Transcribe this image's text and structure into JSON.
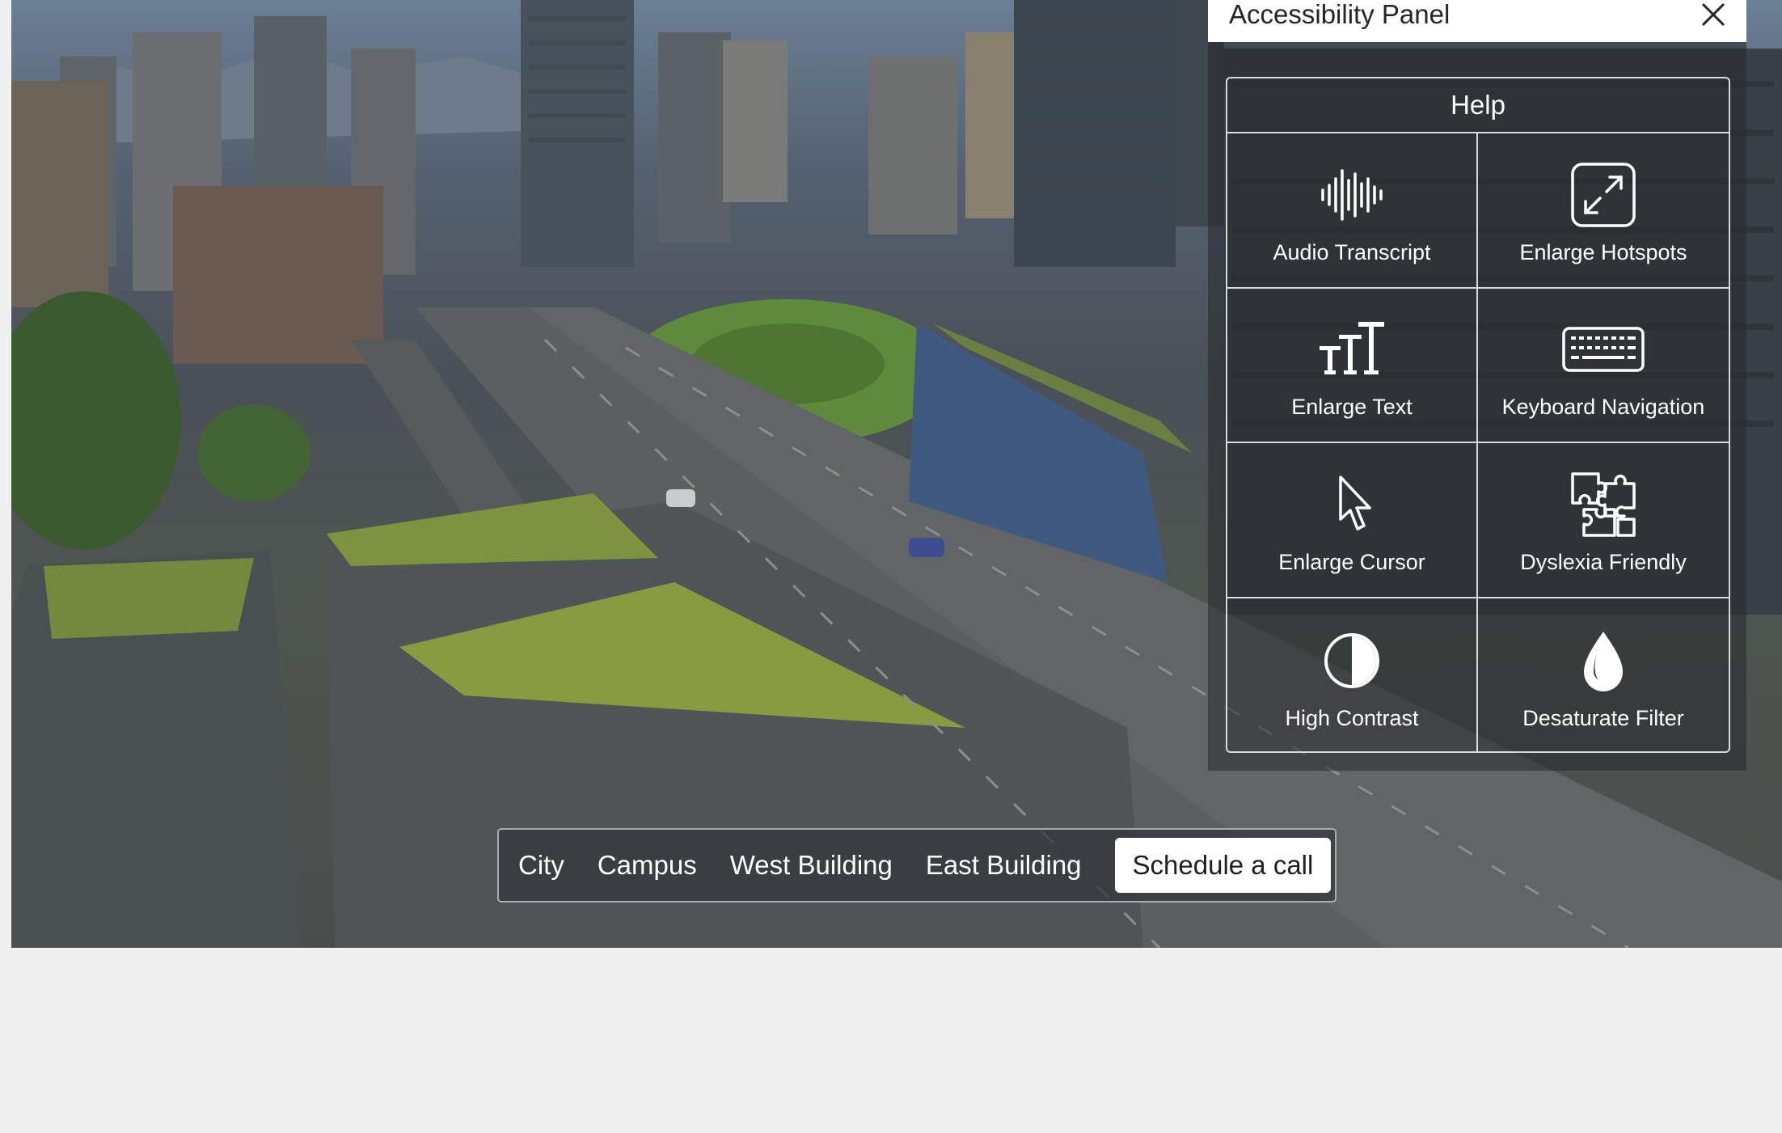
{
  "panel": {
    "title": "Accessibility Panel",
    "help_title": "Help",
    "options": [
      {
        "label": "Audio Transcript",
        "icon": "audio-waveform-icon"
      },
      {
        "label": "Enlarge Hotspots",
        "icon": "expand-arrows-icon"
      },
      {
        "label": "Enlarge Text",
        "icon": "text-size-icon"
      },
      {
        "label": "Keyboard Navigation",
        "icon": "keyboard-icon"
      },
      {
        "label": "Enlarge Cursor",
        "icon": "cursor-arrow-icon"
      },
      {
        "label": "Dyslexia Friendly",
        "icon": "puzzle-icon"
      },
      {
        "label": "High Contrast",
        "icon": "contrast-icon"
      },
      {
        "label": "Desaturate Filter",
        "icon": "drop-icon"
      }
    ]
  },
  "nav": {
    "items": [
      "City",
      "Campus",
      "West Building",
      "East Building"
    ],
    "cta": "Schedule a call"
  },
  "colors": {
    "panel_bg": "#ffffff",
    "overlay": "#26282c",
    "page_bg": "#f0f0f0"
  }
}
